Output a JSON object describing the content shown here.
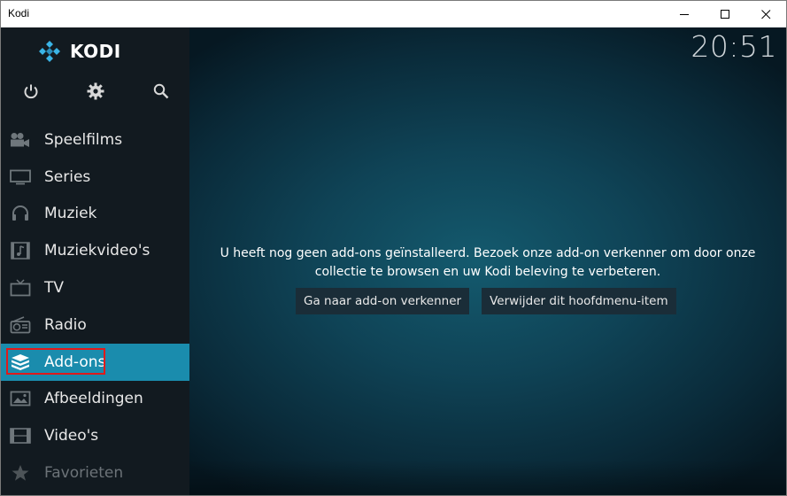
{
  "window": {
    "title": "Kodi"
  },
  "app": {
    "logo_text": "KODI",
    "clock": "20:51"
  },
  "top_icons": [
    "power-icon",
    "gear-icon",
    "search-icon"
  ],
  "menu": {
    "items": [
      {
        "label": "Speelfilms",
        "icon": "movies-camera-icon"
      },
      {
        "label": "Series",
        "icon": "tv-monitor-icon"
      },
      {
        "label": "Muziek",
        "icon": "headphones-icon"
      },
      {
        "label": "Muziekvideo's",
        "icon": "music-video-icon"
      },
      {
        "label": "TV",
        "icon": "tv-antenna-icon"
      },
      {
        "label": "Radio",
        "icon": "radio-icon"
      },
      {
        "label": "Add-ons",
        "icon": "addon-box-icon",
        "selected": true
      },
      {
        "label": "Afbeeldingen",
        "icon": "pictures-icon"
      },
      {
        "label": "Video's",
        "icon": "film-strip-icon"
      },
      {
        "label": "Favorieten",
        "icon": "star-icon"
      }
    ]
  },
  "main": {
    "message": "U heeft nog geen add-ons geïnstalleerd. Bezoek onze add-on verkenner om door onze collectie te browsen en uw Kodi beleving te verbeteren.",
    "buttons": {
      "browse": "Ga naar add-on verkenner",
      "remove": "Verwijder dit hoofdmenu-item"
    }
  },
  "colors": {
    "selected_item": "#1a8cad",
    "highlight_box": "#e01a1a",
    "sidebar_bg": "#121a20",
    "main_bg_center": "#145a6e"
  }
}
